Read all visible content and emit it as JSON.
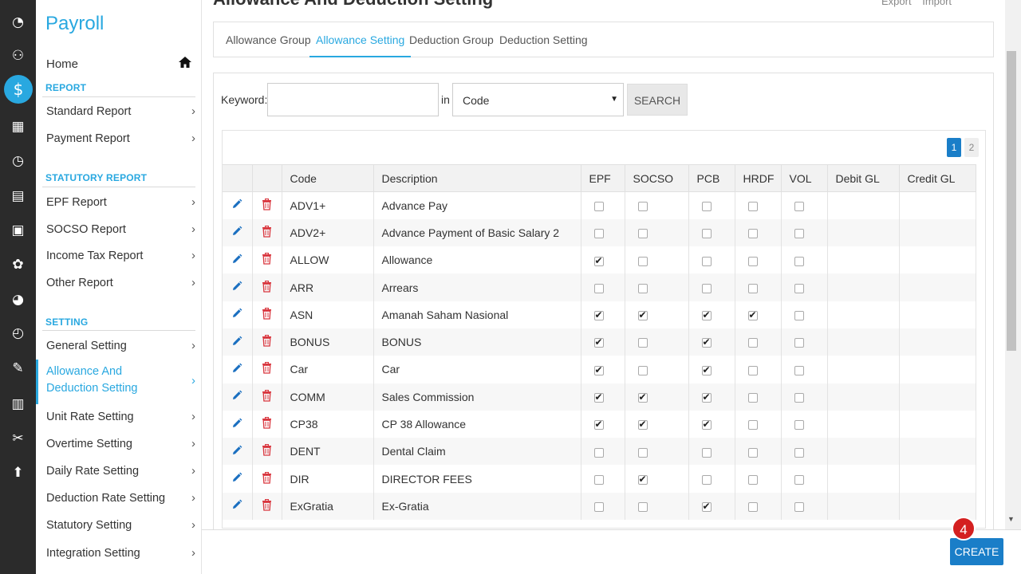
{
  "app": {
    "title": "Payroll"
  },
  "page": {
    "heading": "Allowance And Deduction Setting",
    "export_label": "Export",
    "import_label": "Import"
  },
  "iconbar": {
    "icons": [
      "dashboard-icon",
      "people-icon",
      "payroll-icon",
      "calendar-icon",
      "clock-icon",
      "document-icon",
      "schedule-icon",
      "user-icon",
      "chart-icon",
      "timer-icon",
      "edit-doc-icon",
      "table-icon",
      "tools-icon",
      "upload-icon"
    ],
    "accent": "#29a8e0"
  },
  "sidebar": {
    "home_label": "Home",
    "report": {
      "title": "REPORT",
      "items": [
        "Standard Report",
        "Payment Report"
      ]
    },
    "statutory": {
      "title": "STATUTORY REPORT",
      "items": [
        "EPF Report",
        "SOCSO Report",
        "Income Tax Report",
        "Other Report"
      ]
    },
    "setting": {
      "title": "SETTING",
      "items": [
        "General Setting",
        "Allowance And Deduction Setting",
        "Unit Rate Setting",
        "Overtime Setting",
        "Daily Rate Setting",
        "Deduction Rate Setting",
        "Statutory Setting",
        "Integration Setting"
      ],
      "active_index": 1
    }
  },
  "tabs": [
    "Allowance Group",
    "Allowance Setting",
    "Deduction Group",
    "Deduction Setting"
  ],
  "active_tab": 1,
  "search": {
    "keyword_label": "Keyword:",
    "keyword_value": "",
    "in_label": "in",
    "field_value": "Code",
    "button_label": "SEARCH"
  },
  "pagination": {
    "pages": [
      "1",
      "2"
    ],
    "current": "1"
  },
  "table": {
    "columns": [
      "Code",
      "Description",
      "EPF",
      "SOCSO",
      "PCB",
      "HRDF",
      "VOL",
      "Debit GL",
      "Credit GL"
    ],
    "rows": [
      {
        "code": "ADV1+",
        "description": "Advance Pay",
        "epf": false,
        "socso": false,
        "pcb": false,
        "hrdf": false,
        "vol": false,
        "debit_gl": "",
        "credit_gl": ""
      },
      {
        "code": "ADV2+",
        "description": "Advance Payment of Basic Salary 2",
        "epf": false,
        "socso": false,
        "pcb": false,
        "hrdf": false,
        "vol": false,
        "debit_gl": "",
        "credit_gl": ""
      },
      {
        "code": "ALLOW",
        "description": "Allowance",
        "epf": true,
        "socso": false,
        "pcb": false,
        "hrdf": false,
        "vol": false,
        "debit_gl": "",
        "credit_gl": ""
      },
      {
        "code": "ARR",
        "description": "Arrears",
        "epf": false,
        "socso": false,
        "pcb": false,
        "hrdf": false,
        "vol": false,
        "debit_gl": "",
        "credit_gl": ""
      },
      {
        "code": "ASN",
        "description": "Amanah Saham Nasional",
        "epf": true,
        "socso": true,
        "pcb": true,
        "hrdf": true,
        "vol": false,
        "debit_gl": "",
        "credit_gl": ""
      },
      {
        "code": "BONUS",
        "description": "BONUS",
        "epf": true,
        "socso": false,
        "pcb": true,
        "hrdf": false,
        "vol": false,
        "debit_gl": "",
        "credit_gl": ""
      },
      {
        "code": "Car",
        "description": "Car",
        "epf": true,
        "socso": false,
        "pcb": true,
        "hrdf": false,
        "vol": false,
        "debit_gl": "",
        "credit_gl": ""
      },
      {
        "code": "COMM",
        "description": "Sales Commission",
        "epf": true,
        "socso": true,
        "pcb": true,
        "hrdf": false,
        "vol": false,
        "debit_gl": "",
        "credit_gl": ""
      },
      {
        "code": "CP38",
        "description": "CP 38 Allowance",
        "epf": true,
        "socso": true,
        "pcb": true,
        "hrdf": false,
        "vol": false,
        "debit_gl": "",
        "credit_gl": ""
      },
      {
        "code": "DENT",
        "description": "Dental Claim",
        "epf": false,
        "socso": false,
        "pcb": false,
        "hrdf": false,
        "vol": false,
        "debit_gl": "",
        "credit_gl": ""
      },
      {
        "code": "DIR",
        "description": "DIRECTOR FEES",
        "epf": false,
        "socso": true,
        "pcb": false,
        "hrdf": false,
        "vol": false,
        "debit_gl": "",
        "credit_gl": ""
      },
      {
        "code": "ExGratia",
        "description": "Ex-Gratia",
        "epf": false,
        "socso": false,
        "pcb": true,
        "hrdf": false,
        "vol": false,
        "debit_gl": "",
        "credit_gl": ""
      }
    ]
  },
  "footer": {
    "create_label": "CREATE",
    "step_badge": "4"
  },
  "colors": {
    "primary": "#1a7ec8",
    "accent": "#29a8e0",
    "delete": "#d9363e",
    "badge": "#d42020"
  }
}
